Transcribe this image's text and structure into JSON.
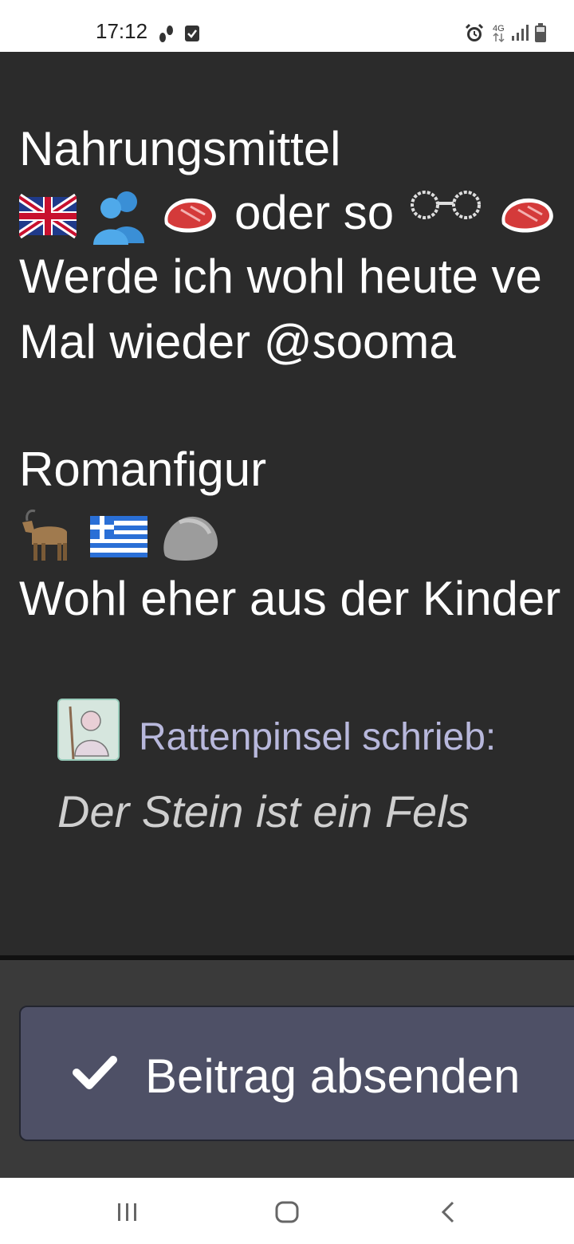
{
  "status_bar": {
    "time": "17:12",
    "network": "4G"
  },
  "post": {
    "lines": [
      "Nahrungsmittel",
      "oder so",
      "Werde ich wohl heute ve",
      "Mal wieder @sooma",
      "Romanfigur",
      "Wohl eher aus der Kinder"
    ],
    "quote": {
      "author_line": "Rattenpinsel schrieb:",
      "text": "Der Stein ist ein Fels"
    }
  },
  "actions": {
    "submit_label": "Beitrag absenden"
  },
  "colors": {
    "background": "#2b2b2b",
    "panel": "#3a3a3a",
    "button": "#4e5066",
    "quote_author": "#b8b8dc"
  },
  "icons": [
    "steps-icon",
    "check-square-icon",
    "alarm-icon",
    "network-4g-icon",
    "signal-icon",
    "battery-icon",
    "uk-flag-icon",
    "people-hugging-icon",
    "steak-icon",
    "glasses-icon",
    "goat-icon",
    "greece-flag-icon",
    "rock-icon",
    "checkmark-icon",
    "recent-apps-icon",
    "home-icon",
    "back-icon"
  ]
}
